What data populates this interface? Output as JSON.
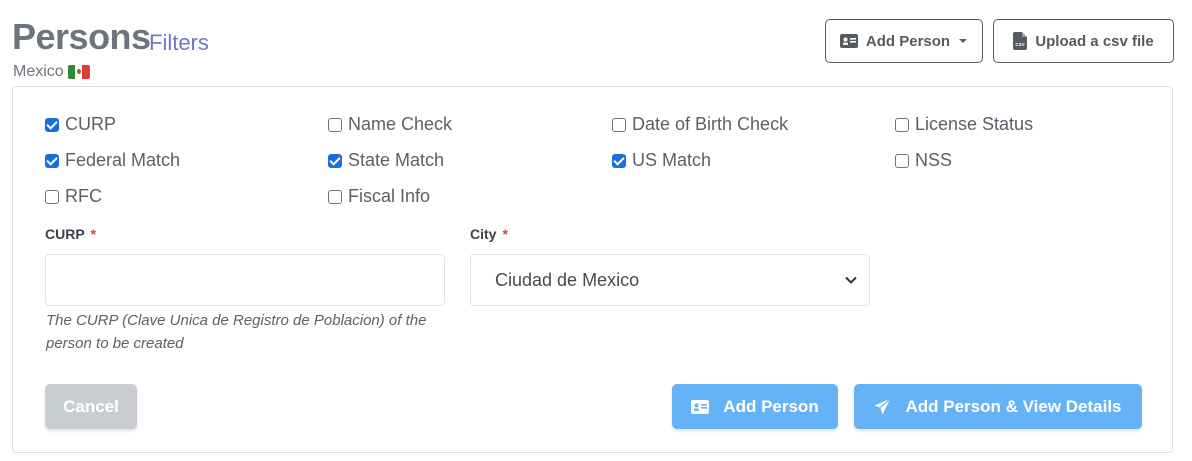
{
  "header": {
    "title": "Persons",
    "filters_label": "Filters",
    "country": "Mexico",
    "add_person_label": "Add Person",
    "upload_csv_label": "Upload a csv file"
  },
  "checks": [
    {
      "label": "CURP",
      "checked": true
    },
    {
      "label": "Name Check",
      "checked": false
    },
    {
      "label": "Date of Birth Check",
      "checked": false
    },
    {
      "label": "License Status",
      "checked": false
    },
    {
      "label": "Federal Match",
      "checked": true
    },
    {
      "label": "State Match",
      "checked": true
    },
    {
      "label": "US Match",
      "checked": true
    },
    {
      "label": "NSS",
      "checked": false
    },
    {
      "label": "RFC",
      "checked": false
    },
    {
      "label": "Fiscal Info",
      "checked": false
    }
  ],
  "form": {
    "curp_label": "CURP",
    "required_mark": "*",
    "curp_value": "",
    "curp_help": "The CURP (Clave Unica de Registro de Poblacion) of the person to be created",
    "city_label": "City",
    "city_value": "Ciudad de Mexico"
  },
  "actions": {
    "cancel": "Cancel",
    "add_person": "Add Person",
    "add_view": "Add Person & View Details"
  },
  "colors": {
    "primary": "#66b2f7",
    "checkbox_on": "#1a6fe0",
    "filters_link": "#6f77c9",
    "required": "#e0413b"
  }
}
